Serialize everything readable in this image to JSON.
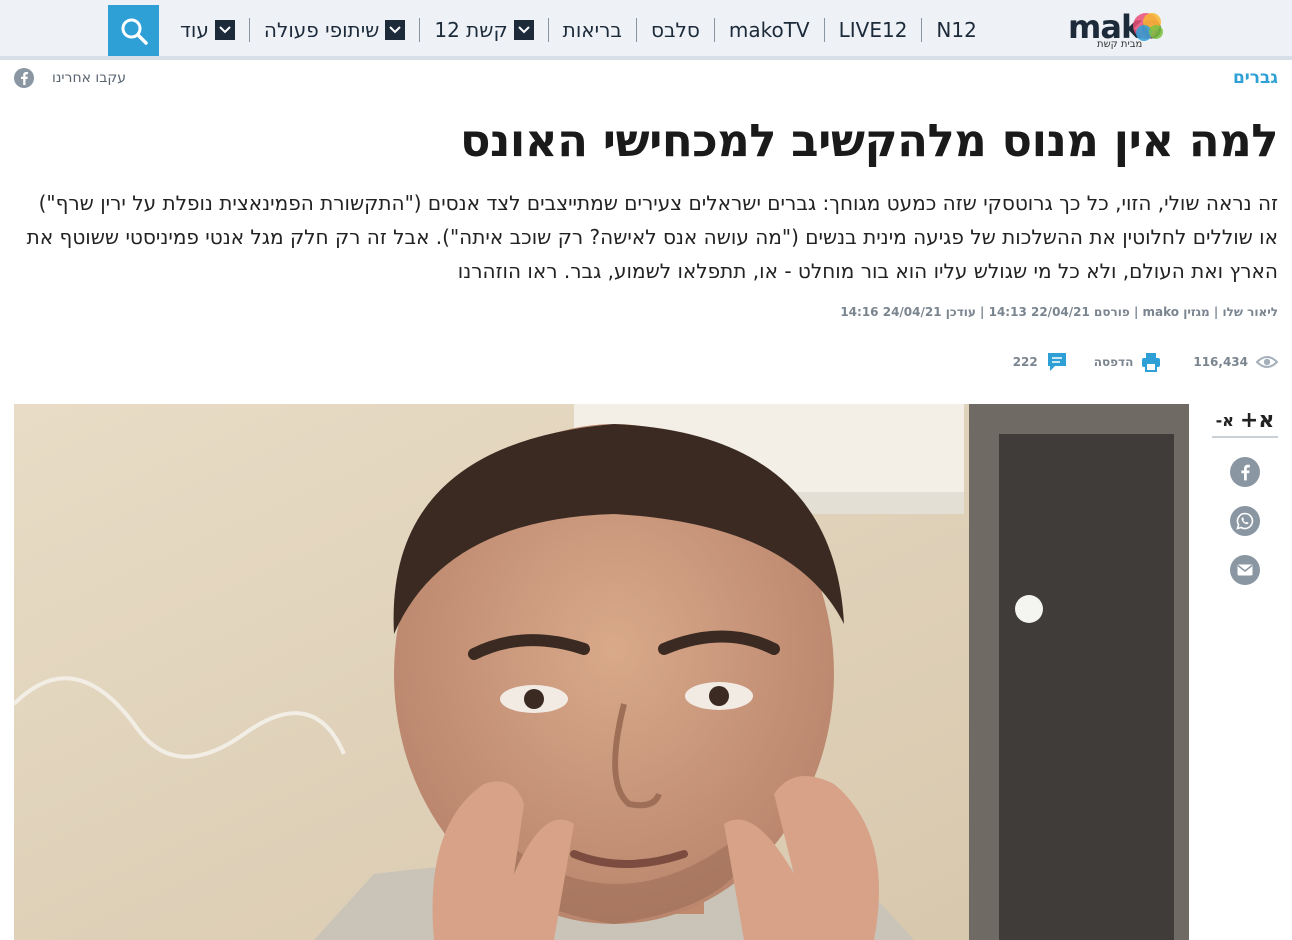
{
  "nav": {
    "logo_text": "mako",
    "logo_subtitle": "מבית קשת",
    "items": [
      {
        "label": "N12",
        "name": "nav-n12"
      },
      {
        "label": "LIVE12",
        "name": "nav-live12"
      },
      {
        "label": "makoTV",
        "name": "nav-makotv"
      },
      {
        "label": "סלבס",
        "name": "nav-celebs"
      },
      {
        "label": "בריאות",
        "name": "nav-health"
      },
      {
        "label": "קשת 12",
        "name": "nav-keshet12",
        "dropdown": true
      },
      {
        "label": "שיתופי פעולה",
        "name": "nav-collaborations",
        "dropdown": true
      },
      {
        "label": "עוד",
        "name": "nav-more",
        "dropdown": true
      }
    ]
  },
  "follow": {
    "label": "עקבו אחרינו"
  },
  "category": "גברים",
  "article": {
    "headline": "למה אין מנוס מלהקשיב למכחישי האונס",
    "subtitle": "זה נראה שולי, הזוי, כל כך גרוטסקי שזה כמעט מגוחך: גברים ישראלים צעירים שמתייצבים לצד אנסים (\"התקשורת הפמינאצית נופלת על ירין שרף\") או שוללים לחלוטין את ההשלכות של פגיעה מינית בנשים (\"מה עושה אנס לאישה? רק שוכב איתה\"). אבל זה רק חלק מגל אנטי פמיניסטי ששוטף את הארץ ואת העולם, ולא כל מי שגולש עליו הוא בור מוחלט - או, תתפלאו לשמוע, גבר. ראו הוזהרנו",
    "byline": "ליאור שלו | מגזין mako | פורסם 22/04/21 14:13 | עודכן 24/04/21 14:16"
  },
  "stats": {
    "views": "116,434",
    "print_label": "הדפסה",
    "comments": "222"
  },
  "rail": {
    "font_increase": "א+",
    "font_decrease": "א-"
  },
  "colors": {
    "accent": "#2ea0d6",
    "nav_bg": "#eef2f6",
    "icon_gray": "#8a97a3"
  }
}
